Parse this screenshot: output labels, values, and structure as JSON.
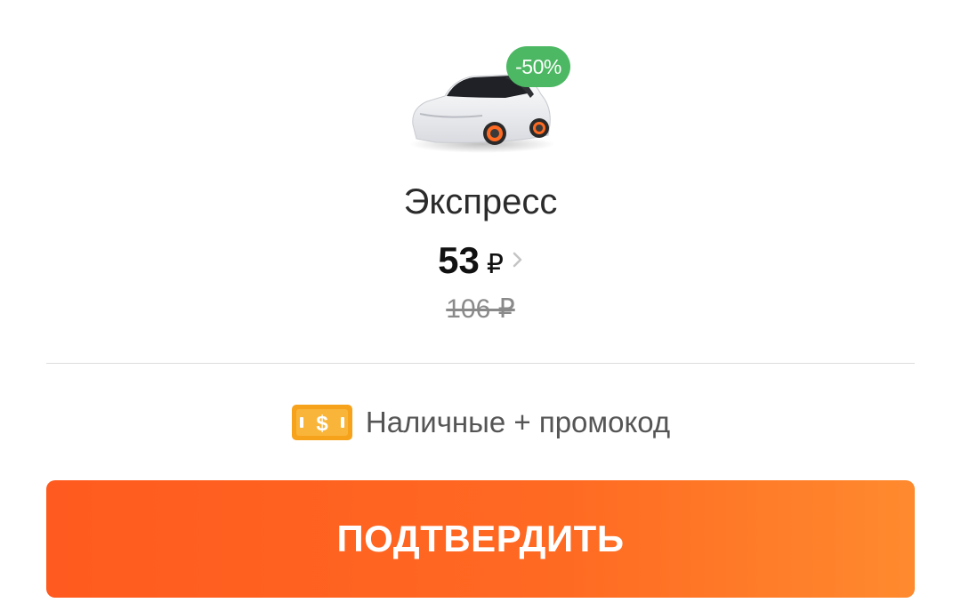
{
  "tariff": {
    "name": "Экспресс",
    "discount_badge": "-50%",
    "price_value": "53",
    "price_currency": "₽",
    "old_price": "106 ₽"
  },
  "payment": {
    "label": "Наличные + промокод",
    "icon": "cash-icon"
  },
  "actions": {
    "confirm_label": "ПОДТВЕРДИТЬ"
  },
  "colors": {
    "accent": "#ff6a22",
    "badge": "#4cb863"
  }
}
